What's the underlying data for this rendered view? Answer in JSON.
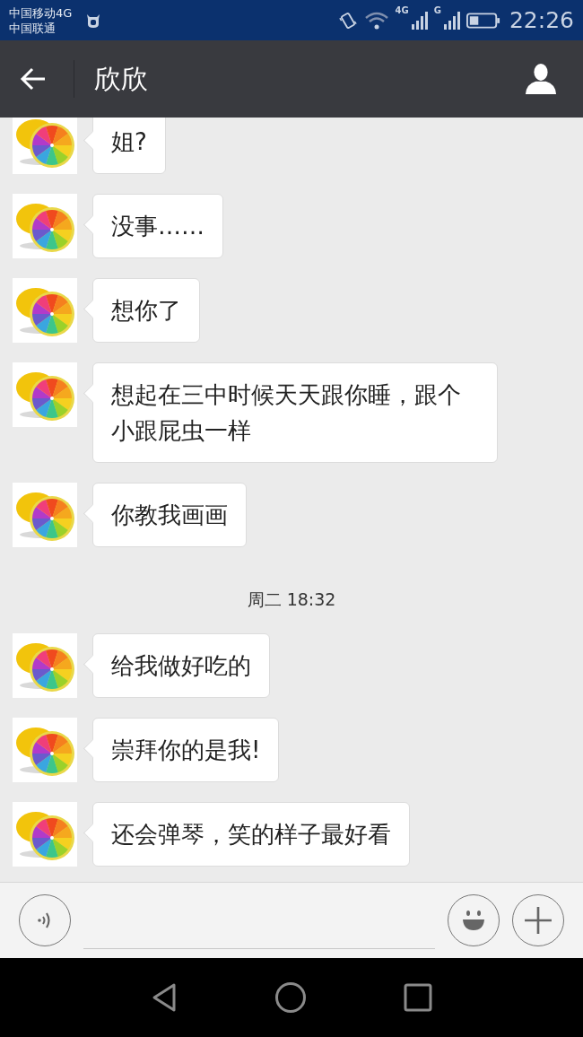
{
  "status_bar": {
    "carriers": [
      "中国移动4G",
      "中国联通"
    ],
    "network_labels": [
      "4G",
      "G"
    ],
    "time": "22:26"
  },
  "header": {
    "title": "欣欣"
  },
  "messages": [
    {
      "kind": "message",
      "text": "姐?"
    },
    {
      "kind": "message",
      "text": "没事……"
    },
    {
      "kind": "message",
      "text": "想你了"
    },
    {
      "kind": "message",
      "text": "想起在三中时候天天跟你睡，跟个小跟屁虫一样"
    },
    {
      "kind": "message",
      "text": "你教我画画"
    },
    {
      "kind": "time",
      "text": "周二 18:32"
    },
    {
      "kind": "message",
      "text": "给我做好吃的"
    },
    {
      "kind": "message",
      "text": "崇拜你的是我!"
    },
    {
      "kind": "message",
      "text": "还会弹琴，笑的样子最好看"
    }
  ]
}
